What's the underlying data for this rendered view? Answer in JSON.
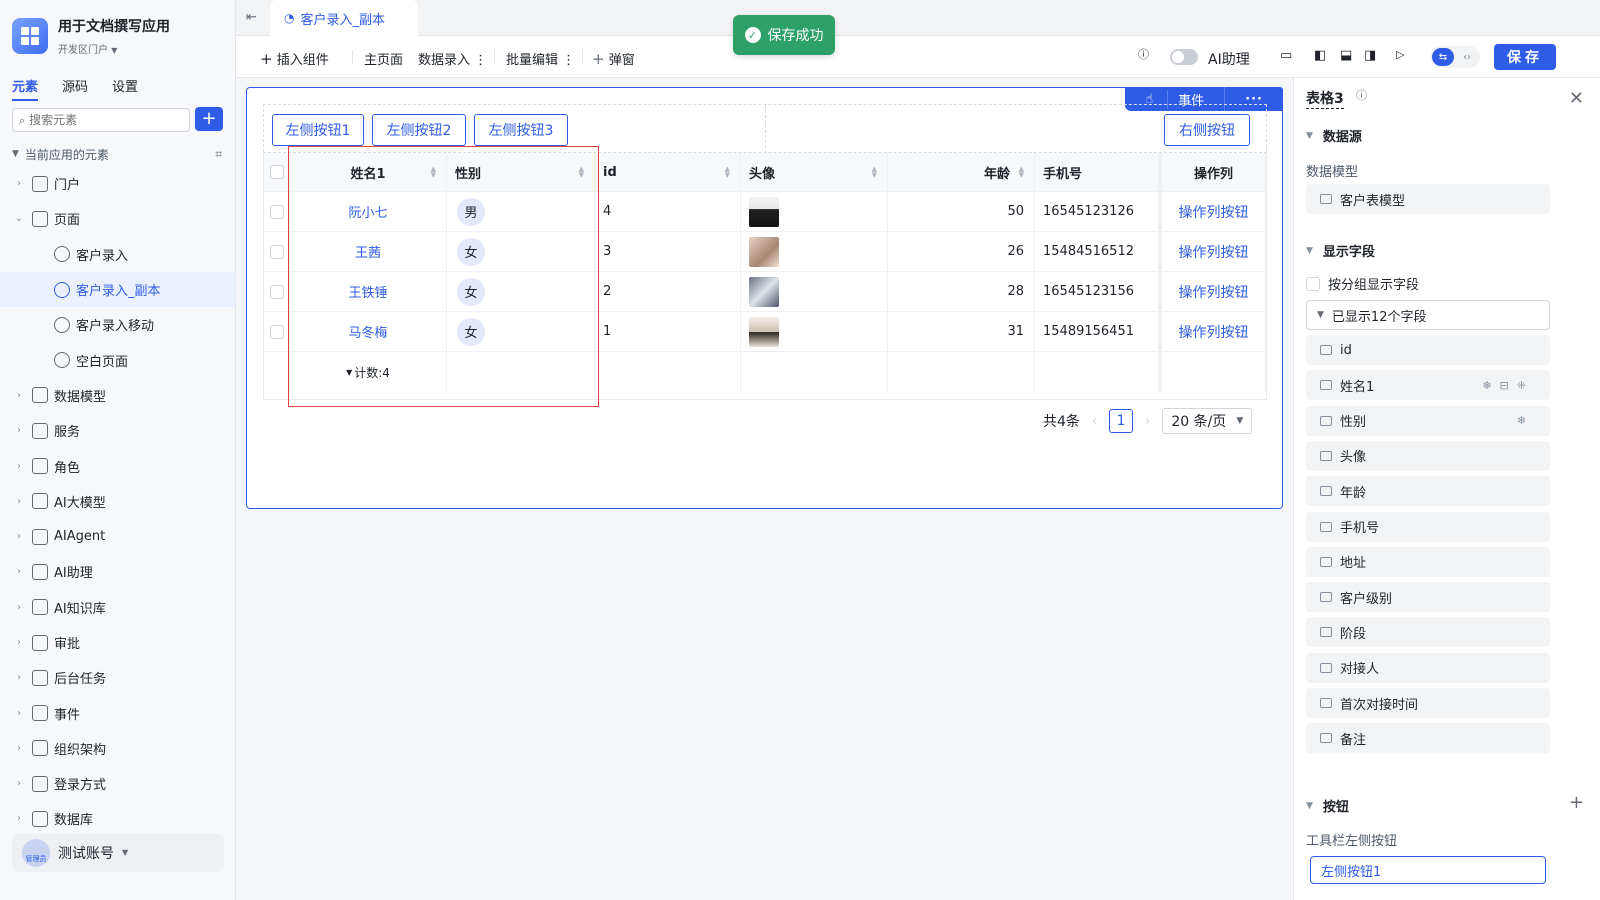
{
  "app": {
    "title": "用于文档撰写应用",
    "portal": "开发区门户"
  },
  "sidebar": {
    "tabs": [
      "元素",
      "源码",
      "设置"
    ],
    "search_placeholder": "搜索元素",
    "tree_header": "当前应用的元素",
    "items": [
      {
        "label": "门户",
        "icon": "home-icon",
        "level": 0
      },
      {
        "label": "页面",
        "icon": "page-icon",
        "level": 0
      },
      {
        "label": "客户录入",
        "icon": "form-icon",
        "level": 1
      },
      {
        "label": "客户录入_副本",
        "icon": "form-icon",
        "level": 1,
        "selected": true
      },
      {
        "label": "客户录入移动",
        "icon": "form-icon",
        "level": 1
      },
      {
        "label": "空白页面",
        "icon": "form-icon",
        "level": 1
      },
      {
        "label": "数据模型",
        "icon": "table-icon",
        "level": 0
      },
      {
        "label": "服务",
        "icon": "service-icon",
        "level": 0
      },
      {
        "label": "角色",
        "icon": "role-icon",
        "level": 0
      },
      {
        "label": "AI大模型",
        "icon": "model-icon",
        "level": 0
      },
      {
        "label": "AIAgent",
        "icon": "robot-icon",
        "level": 0
      },
      {
        "label": "AI助理",
        "icon": "ai-icon",
        "level": 0
      },
      {
        "label": "AI知识库",
        "icon": "book-icon",
        "level": 0
      },
      {
        "label": "审批",
        "icon": "stamp-icon",
        "level": 0
      },
      {
        "label": "后台任务",
        "icon": "task-icon",
        "level": 0
      },
      {
        "label": "事件",
        "icon": "event-icon",
        "level": 0
      },
      {
        "label": "组织架构",
        "icon": "org-icon",
        "level": 0
      },
      {
        "label": "登录方式",
        "icon": "login-icon",
        "level": 0
      },
      {
        "label": "数据库",
        "icon": "database-icon",
        "level": 0
      }
    ],
    "user": {
      "name": "测试账号",
      "role": "管理员"
    }
  },
  "tabbar": {
    "active_tab": "客户录入_副本"
  },
  "toolbar": {
    "insert": "插入组件",
    "home": "主页面",
    "data_entry": "数据录入",
    "batch_edit": "批量编辑",
    "popup": "弹窗",
    "ai_assistant": "AI助理",
    "save": "保存"
  },
  "toast": {
    "message": "保存成功"
  },
  "component": {
    "actions": {
      "event": "事件"
    },
    "left_buttons": [
      "左侧按钮1",
      "左侧按钮2",
      "左侧按钮3"
    ],
    "right_button": "右侧按钮",
    "columns": [
      "姓名1",
      "性别",
      "id",
      "头像",
      "年龄",
      "手机号",
      "操作列"
    ],
    "rows": [
      {
        "name": "阮小七",
        "gender": "男",
        "id": "4",
        "age": "50",
        "phone": "16545123126",
        "action": "操作列按钮"
      },
      {
        "name": "王茜",
        "gender": "女",
        "id": "3",
        "age": "26",
        "phone": "15484516512",
        "action": "操作列按钮"
      },
      {
        "name": "王铁锤",
        "gender": "女",
        "id": "2",
        "age": "28",
        "phone": "16545123156",
        "action": "操作列按钮"
      },
      {
        "name": "马冬梅",
        "gender": "女",
        "id": "1",
        "age": "31",
        "phone": "15489156451",
        "action": "操作列按钮"
      }
    ],
    "count": "计数:4",
    "pager": {
      "total": "共4条",
      "page": "1",
      "page_size": "20 条/页"
    }
  },
  "panel": {
    "title": "表格3",
    "datasource_title": "数据源",
    "model_label": "数据模型",
    "model_value": "客户表模型",
    "fields_title": "显示字段",
    "group_check": "按分组显示字段",
    "shown_fields": "已显示12个字段",
    "fields": [
      "id",
      "姓名1",
      "性别",
      "头像",
      "年龄",
      "手机号",
      "地址",
      "客户级别",
      "阶段",
      "对接人",
      "首次对接时间",
      "备注"
    ],
    "buttons_title": "按钮",
    "toolbar_left_label": "工具栏左侧按钮",
    "toolbar_left_value": "左侧按钮1"
  },
  "colors": {
    "accent": "#2e5ce6",
    "success": "#2ea169",
    "highlight_border": "#e0423c"
  }
}
